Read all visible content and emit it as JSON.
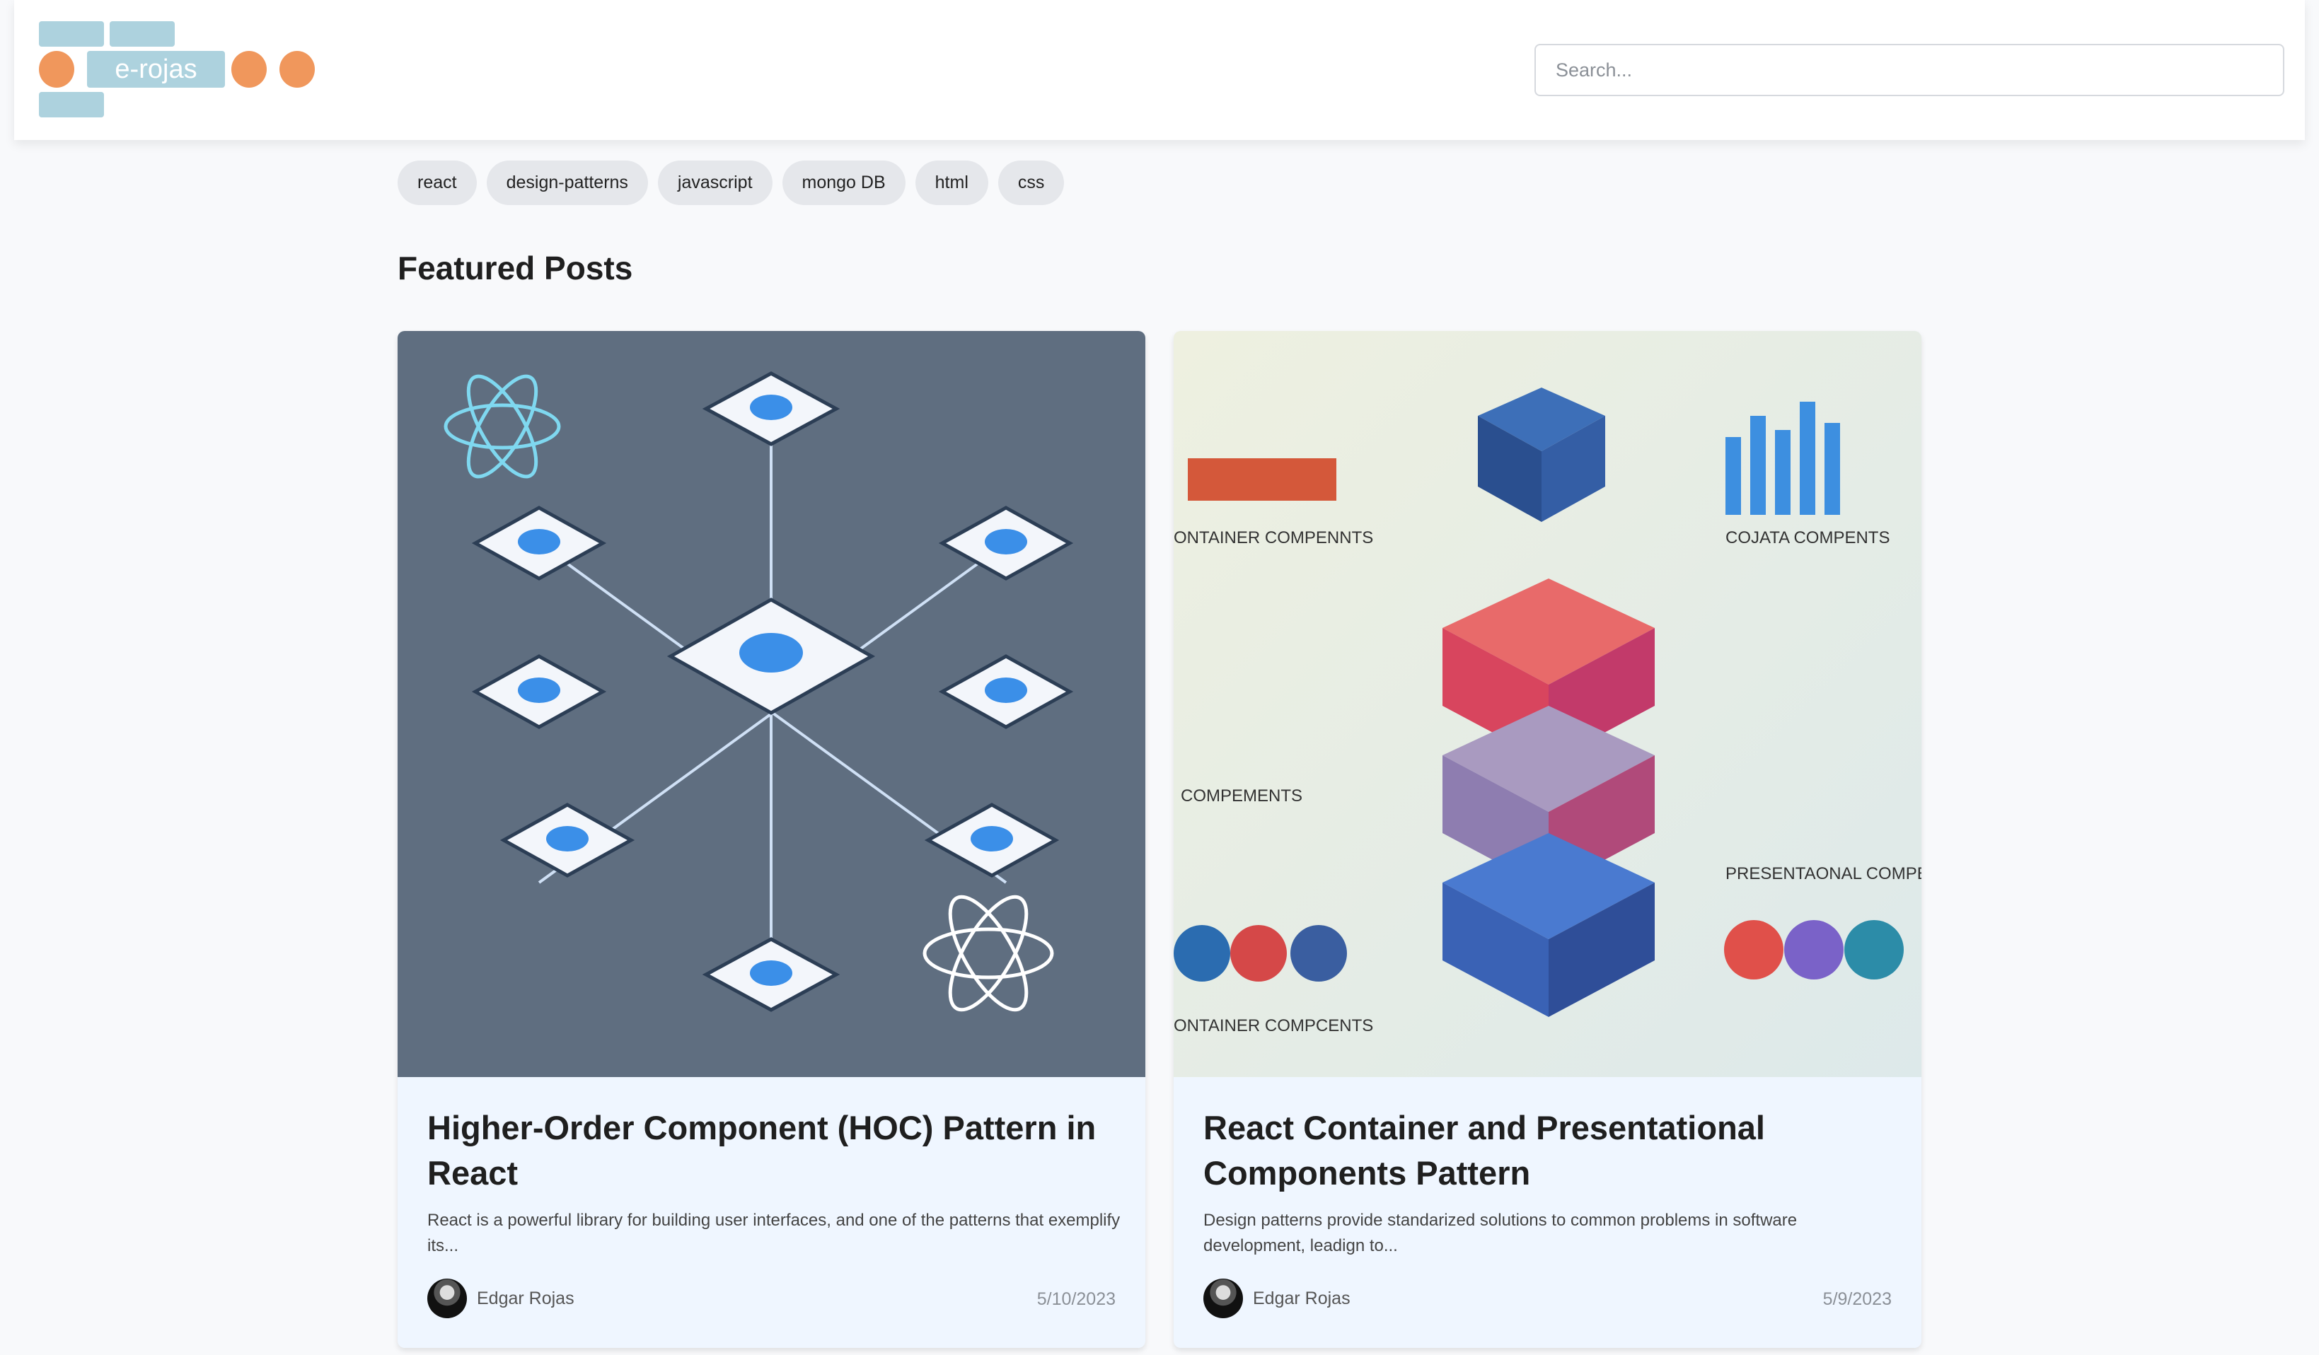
{
  "header": {
    "logo_text": "e-rojas",
    "search_placeholder": "Search..."
  },
  "tags": [
    "react",
    "design-patterns",
    "javascript",
    "mongo DB",
    "html",
    "css"
  ],
  "featured": {
    "title": "Featured Posts"
  },
  "posts": [
    {
      "title": "Higher-Order Component (HOC) Pattern in React",
      "excerpt": "React is a powerful library for building user interfaces, and one of the patterns that exemplify its...",
      "author": "Edgar Rojas",
      "date": "5/10/2023"
    },
    {
      "title": "React Container and Presentational Components Pattern",
      "excerpt": "Design patterns provide standarized solutions to common problems in software development, leadign to...",
      "author": "Edgar Rojas",
      "date": "5/9/2023",
      "image_labels": [
        "ONTAINER COMPENNTS",
        "COJATA COMPENTS",
        "COMPEMENTS",
        "PRESENTAONAL COMPEMENTS",
        "ONTAINER COMPCENTS"
      ]
    }
  ],
  "colors": {
    "logo_blue": "#add2de",
    "logo_orange": "#f0975c",
    "card_bg": "#eff6ff"
  }
}
